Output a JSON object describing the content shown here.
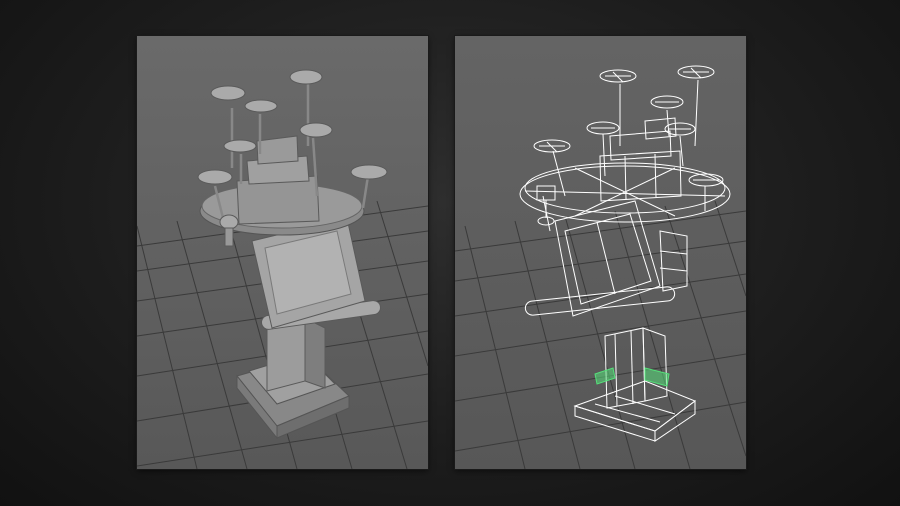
{
  "scene": {
    "object": "lectern-with-lamps",
    "colors": {
      "background": "#1d1d1d",
      "viewport_bg": "#606060",
      "grid": "#3c3c3c",
      "shaded_model": "#9a9a9a",
      "shaded_model_dark": "#777777",
      "wireframe": "#ffffff",
      "selection": "#55e07a"
    }
  },
  "viewports": [
    {
      "mode": "shaded"
    },
    {
      "mode": "wireframe"
    }
  ]
}
